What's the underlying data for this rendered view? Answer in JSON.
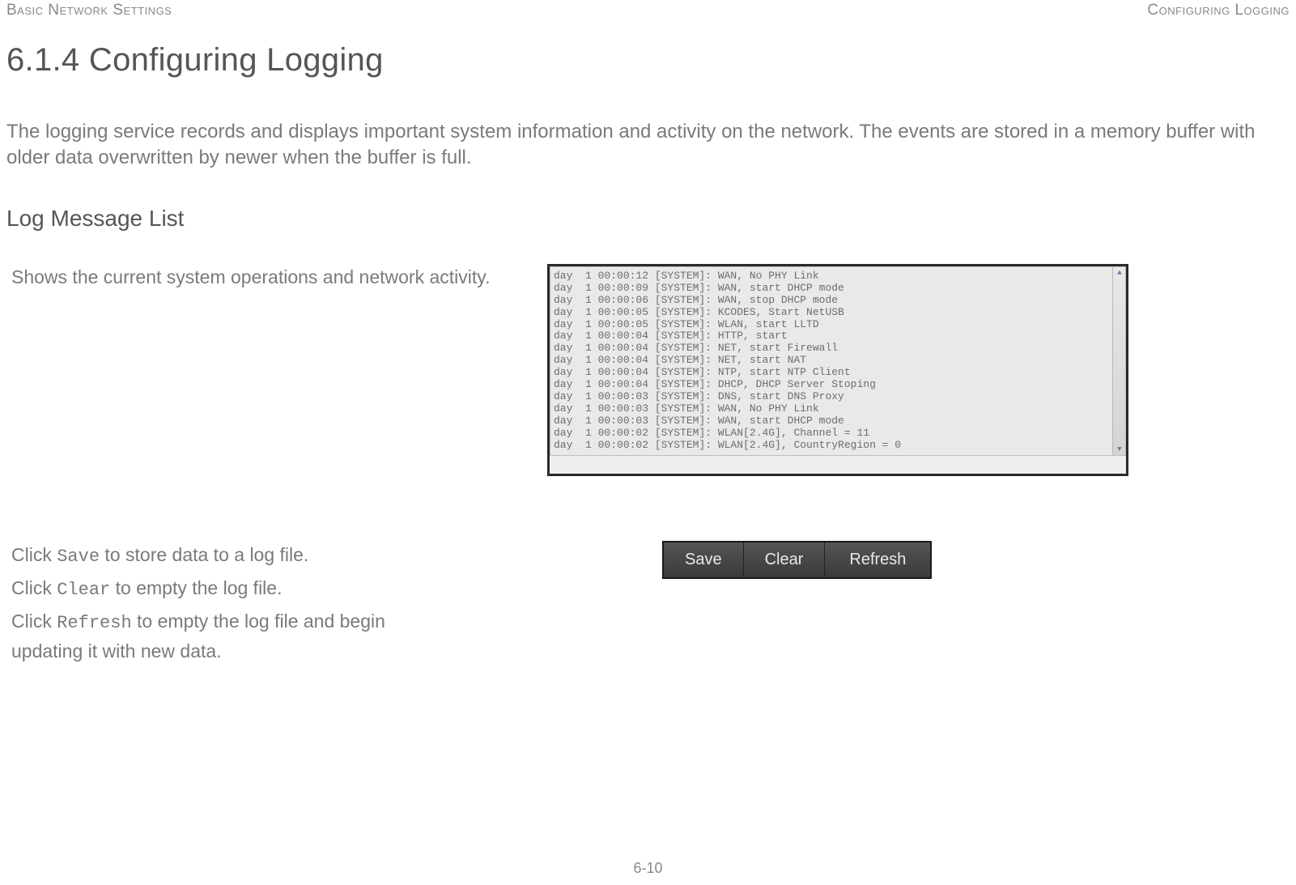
{
  "header": {
    "left": "Basic Network Settings",
    "right": "Configuring Logging"
  },
  "title": "6.1.4 Configuring Logging",
  "intro": "The logging service records and displays important system information and activity on the network. The events are stored in a memory buffer with older data overwritten by newer when the buffer is full.",
  "subheading": "Log Message List",
  "log_desc": "Shows the current system operations and network activity.",
  "log_lines": [
    "day  1 00:00:12 [SYSTEM]: WAN, No PHY Link",
    "day  1 00:00:09 [SYSTEM]: WAN, start DHCP mode",
    "day  1 00:00:06 [SYSTEM]: WAN, stop DHCP mode",
    "day  1 00:00:05 [SYSTEM]: KCODES, Start NetUSB",
    "day  1 00:00:05 [SYSTEM]: WLAN, start LLTD",
    "day  1 00:00:04 [SYSTEM]: HTTP, start",
    "day  1 00:00:04 [SYSTEM]: NET, start Firewall",
    "day  1 00:00:04 [SYSTEM]: NET, start NAT",
    "day  1 00:00:04 [SYSTEM]: NTP, start NTP Client",
    "day  1 00:00:04 [SYSTEM]: DHCP, DHCP Server Stoping",
    "day  1 00:00:03 [SYSTEM]: DNS, start DNS Proxy",
    "day  1 00:00:03 [SYSTEM]: WAN, No PHY Link",
    "day  1 00:00:03 [SYSTEM]: WAN, start DHCP mode",
    "day  1 00:00:02 [SYSTEM]: WLAN[2.4G], Channel = 11",
    "day  1 00:00:02 [SYSTEM]: WLAN[2.4G], CountryRegion = 0"
  ],
  "instructions": {
    "save_pre": "Click ",
    "save_cmd": "Save",
    "save_post": " to store data to a log file.",
    "clear_pre": "Click ",
    "clear_cmd": "Clear",
    "clear_post": " to empty the log file.",
    "refresh_pre": "Click ",
    "refresh_cmd": "Refresh",
    "refresh_post": " to empty the log file and begin updating it with new data."
  },
  "buttons": {
    "save": "Save",
    "clear": "Clear",
    "refresh": "Refresh"
  },
  "page_number": "6-10"
}
